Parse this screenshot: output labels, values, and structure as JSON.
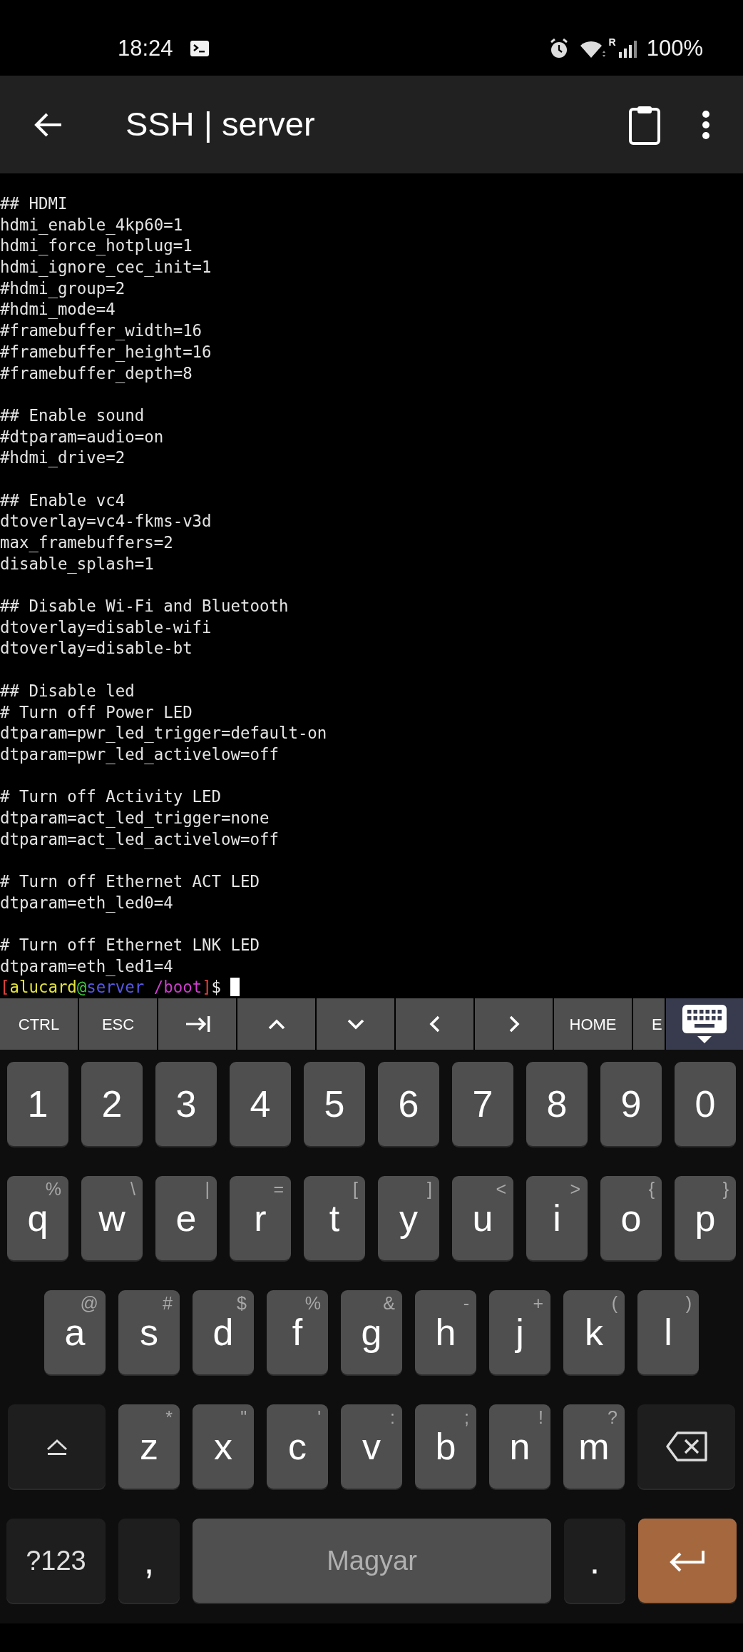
{
  "status_bar": {
    "time": "18:24",
    "roaming_label": "R",
    "battery": "100%"
  },
  "app_bar": {
    "title": "SSH | server"
  },
  "terminal": {
    "blocks": [
      [
        "## HDMI",
        "hdmi_enable_4kp60=1",
        "hdmi_force_hotplug=1",
        "hdmi_ignore_cec_init=1",
        "#hdmi_group=2",
        "#hdmi_mode=4",
        "#framebuffer_width=16",
        "#framebuffer_height=16",
        "#framebuffer_depth=8"
      ],
      [
        "## Enable sound",
        "#dtparam=audio=on",
        "#hdmi_drive=2"
      ],
      [
        "## Enable vc4",
        "dtoverlay=vc4-fkms-v3d",
        "max_framebuffers=2",
        "disable_splash=1"
      ],
      [
        "## Disable Wi-Fi and Bluetooth",
        "dtoverlay=disable-wifi",
        "dtoverlay=disable-bt"
      ],
      [
        "## Disable led",
        "# Turn off Power LED",
        "dtparam=pwr_led_trigger=default-on",
        "dtparam=pwr_led_activelow=off"
      ],
      [
        "# Turn off Activity LED",
        "dtparam=act_led_trigger=none",
        "dtparam=act_led_activelow=off"
      ],
      [
        "# Turn off Ethernet ACT LED",
        "dtparam=eth_led0=4"
      ],
      [
        "# Turn off Ethernet LNK LED",
        "dtparam=eth_led1=4"
      ]
    ],
    "prompt": [
      {
        "text": "[",
        "color": "#e0403a"
      },
      {
        "text": "alucard",
        "color": "#e4e43a"
      },
      {
        "text": "@",
        "color": "#3fcf3f"
      },
      {
        "text": "server",
        "color": "#5858e8"
      },
      {
        "text": " /boot",
        "color": "#d03ed0"
      },
      {
        "text": "]",
        "color": "#e0403a"
      },
      {
        "text": "$",
        "color": "#e6e6e6"
      }
    ]
  },
  "extra_keys": [
    {
      "kind": "text",
      "label": "CTRL"
    },
    {
      "kind": "text",
      "label": "ESC"
    },
    {
      "kind": "tab"
    },
    {
      "kind": "up"
    },
    {
      "kind": "down"
    },
    {
      "kind": "left"
    },
    {
      "kind": "right"
    },
    {
      "kind": "text",
      "label": "HOME"
    },
    {
      "kind": "text",
      "label": "E"
    }
  ],
  "keyboard": {
    "key_rows": [
      {
        "keys": [
          {
            "kind": "char",
            "label": "1"
          },
          {
            "kind": "char",
            "label": "2"
          },
          {
            "kind": "char",
            "label": "3"
          },
          {
            "kind": "char",
            "label": "4"
          },
          {
            "kind": "char",
            "label": "5"
          },
          {
            "kind": "char",
            "label": "6"
          },
          {
            "kind": "char",
            "label": "7"
          },
          {
            "kind": "char",
            "label": "8"
          },
          {
            "kind": "char",
            "label": "9"
          },
          {
            "kind": "char",
            "label": "0"
          }
        ]
      },
      {
        "keys": [
          {
            "kind": "char",
            "label": "q",
            "hint": "%"
          },
          {
            "kind": "char",
            "label": "w",
            "hint": "\\"
          },
          {
            "kind": "char",
            "label": "e",
            "hint": "|"
          },
          {
            "kind": "char",
            "label": "r",
            "hint": "="
          },
          {
            "kind": "char",
            "label": "t",
            "hint": "["
          },
          {
            "kind": "char",
            "label": "y",
            "hint": "]"
          },
          {
            "kind": "char",
            "label": "u",
            "hint": "<"
          },
          {
            "kind": "char",
            "label": "i",
            "hint": ">"
          },
          {
            "kind": "char",
            "label": "o",
            "hint": "{"
          },
          {
            "kind": "char",
            "label": "p",
            "hint": "}"
          }
        ]
      },
      {
        "keys": [
          {
            "kind": "char",
            "label": "a",
            "hint": "@"
          },
          {
            "kind": "char",
            "label": "s",
            "hint": "#"
          },
          {
            "kind": "char",
            "label": "d",
            "hint": "$"
          },
          {
            "kind": "char",
            "label": "f",
            "hint": "%"
          },
          {
            "kind": "char",
            "label": "g",
            "hint": "&"
          },
          {
            "kind": "char",
            "label": "h",
            "hint": "-"
          },
          {
            "kind": "char",
            "label": "j",
            "hint": "+"
          },
          {
            "kind": "char",
            "label": "k",
            "hint": "("
          },
          {
            "kind": "char",
            "label": "l",
            "hint": ")"
          }
        ]
      },
      {
        "keys": [
          {
            "kind": "shift"
          },
          {
            "kind": "char",
            "label": "z",
            "hint": "*"
          },
          {
            "kind": "char",
            "label": "x",
            "hint": "\""
          },
          {
            "kind": "char",
            "label": "c",
            "hint": "'"
          },
          {
            "kind": "char",
            "label": "v",
            "hint": ":"
          },
          {
            "kind": "char",
            "label": "b",
            "hint": ";"
          },
          {
            "kind": "char",
            "label": "n",
            "hint": "!"
          },
          {
            "kind": "char",
            "label": "m",
            "hint": "?"
          },
          {
            "kind": "backspace"
          }
        ]
      },
      {
        "keys": [
          {
            "kind": "symbols",
            "label": "?123"
          },
          {
            "kind": "punct",
            "label": ","
          },
          {
            "kind": "space",
            "label": "Magyar"
          },
          {
            "kind": "punct",
            "label": "."
          },
          {
            "kind": "enter"
          }
        ]
      }
    ]
  }
}
